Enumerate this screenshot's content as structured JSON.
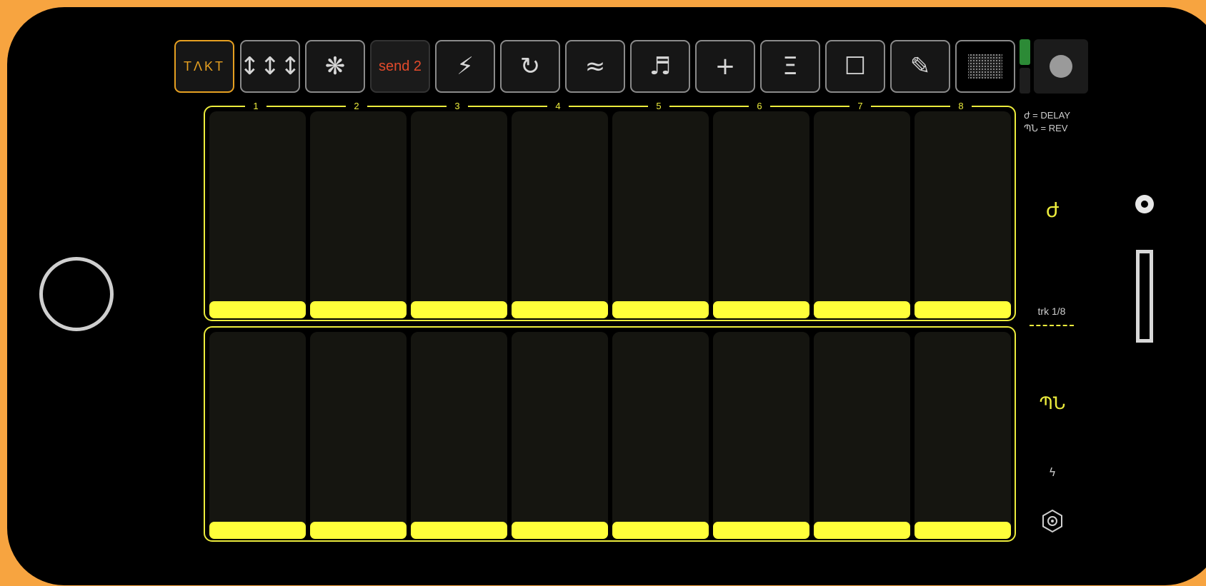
{
  "toolbar": {
    "takt_label": "TΛKT",
    "arrows_glyph": "↕↕↕",
    "fx_glyph": "❋",
    "send_label": "send 2",
    "bolt_glyph": "⚡",
    "loop_glyph": "↻",
    "wave_glyph": "≈",
    "note_glyph": "♬",
    "plus_glyph": "+",
    "menu_glyph": "Ξ",
    "square_glyph": "☐",
    "pencil_glyph": "✎"
  },
  "channels": [
    "1",
    "2",
    "3",
    "4",
    "5",
    "6",
    "7",
    "8"
  ],
  "banks": [
    {
      "name": "delay",
      "levels": [
        0.1,
        0.1,
        0.1,
        0.1,
        0.1,
        0.1,
        0.1,
        0.1
      ]
    },
    {
      "name": "reverb",
      "levels": [
        0.1,
        0.1,
        0.1,
        0.1,
        0.1,
        0.1,
        0.1,
        0.1
      ]
    }
  ],
  "legend": {
    "delay": "ժ = DELAY",
    "rev": "ՊՆ = REV"
  },
  "side": {
    "delay_glyph": "ժ",
    "rev_glyph": "ՊՆ",
    "track_label": "trk 1/8",
    "bolt_glyph": "ϟ"
  },
  "colors": {
    "accent": "#FFFF3A",
    "takt_orange": "#E6A021",
    "send_red": "#E24A2B",
    "level_green": "#2c8a36",
    "frame": "#F7A440"
  },
  "icons": [
    "takt-logo",
    "arrows-icon",
    "fx-icon",
    "bolt-icon",
    "loop-icon",
    "wave-icon",
    "note-icon",
    "plus-icon",
    "menu-icon",
    "square-icon",
    "pencil-icon",
    "noise-icon",
    "record-icon",
    "gear-icon"
  ]
}
